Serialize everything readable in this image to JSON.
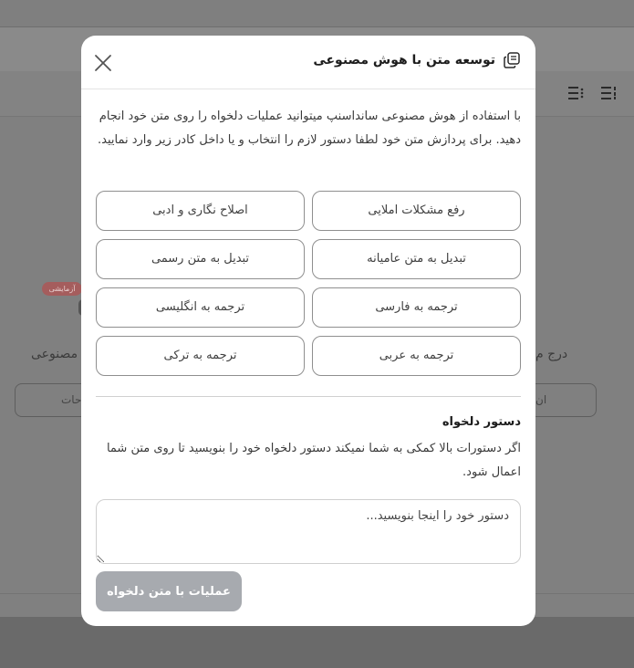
{
  "background": {
    "badge": "آزمایشی",
    "left_label": "مصنوعی",
    "right_label": "درج م",
    "left_button": "ات",
    "left_button_2": "حات",
    "right_button": "ان"
  },
  "modal": {
    "title": "توسعه متن با هوش مصنوعی",
    "intro": "با استفاده از هوش مصنوعی سانداسنپ میتوانید عملیات دلخواه را روی متن خود انجام دهید. برای پردازش متن خود لطفا دستور لازم را انتخاب و یا داخل کادر زیر وارد نمایید.",
    "options": [
      "رفع مشکلات املایی",
      "اصلاح نگاری و ادبی",
      "تبدیل به متن عامیانه",
      "تبدیل به متن رسمی",
      "ترجمه به فارسی",
      "ترجمه به انگلیسی",
      "ترجمه به عربی",
      "ترجمه به ترکی"
    ],
    "custom_title": "دستور دلخواه",
    "custom_desc": "اگر دستورات بالا کمکی به شما نمیکند دستور دلخواه خود را بنویسید تا روی متن شما اعمال شود.",
    "input_placeholder": "دستور خود را اینجا بنویسید...",
    "submit_label": "عملیات با متن دلخواه"
  },
  "colors": {
    "submit_disabled": "#a7aaaf",
    "badge": "#a55d5d"
  }
}
